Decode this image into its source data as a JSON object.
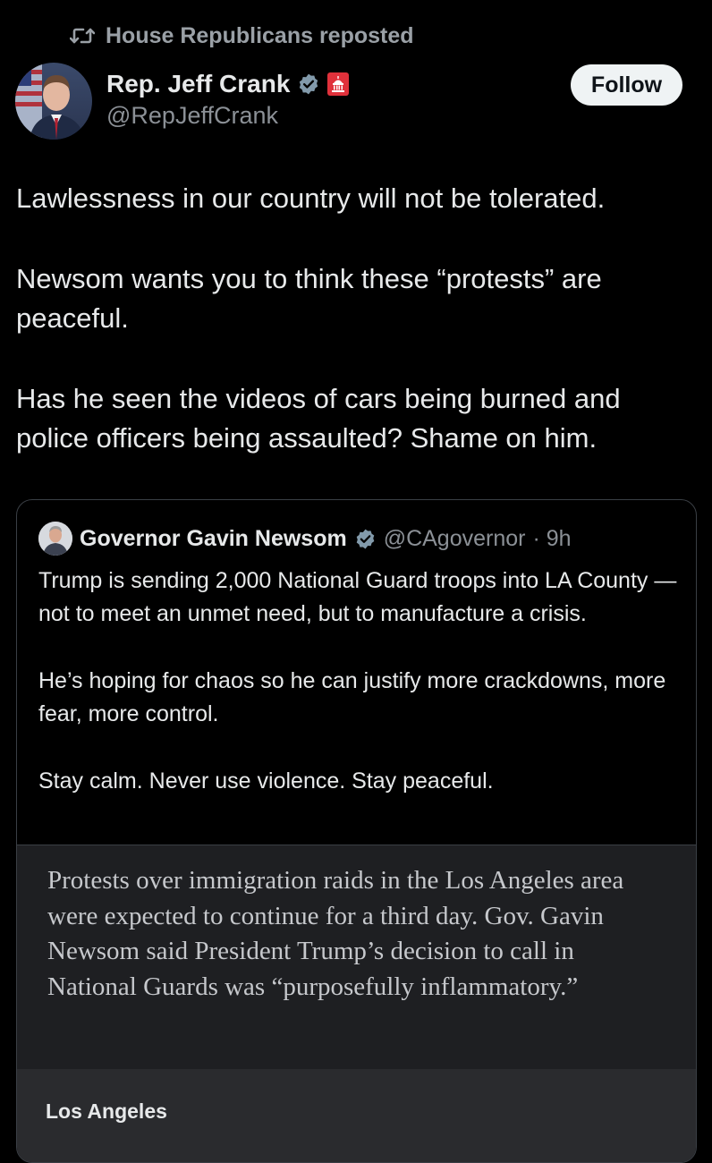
{
  "repost": {
    "label": "House Republicans reposted",
    "icon": "repost-icon"
  },
  "author": {
    "name": "Rep. Jeff Crank",
    "handle": "@RepJeffCrank",
    "verified_icon": "verified-badge-icon",
    "affiliation_icon": "government-badge-icon"
  },
  "follow": {
    "label": "Follow"
  },
  "post": {
    "paragraphs": [
      "Lawlessness in our country will not be tolerated.",
      "Newsom wants you to think these “protests” are peaceful.",
      "Has he seen the videos of cars being burned and police officers being assaulted? Shame on him."
    ]
  },
  "quote": {
    "name": "Governor Gavin Newsom",
    "handle": "@CAgovernor",
    "time": "· 9h",
    "paragraphs": [
      "Trump is sending 2,000 National Guard troops into LA County — not to meet an unmet need, but to manufacture a crisis.",
      "He’s hoping for chaos so he can justify more crackdowns, more fear, more control.",
      "Stay calm. Never use violence. Stay peaceful."
    ],
    "media": {
      "text": "Protests over immigration raids in the Los Angeles area were expected to continue for a third day. Gov. Gavin Newsom said President Trump’s decision to call in National Guards was “purposefully inflammatory.”",
      "tag": "Los Angeles"
    }
  },
  "colors": {
    "background": "#000000",
    "text": "#e7e9ea",
    "secondary": "#8b9096",
    "verified": "#829aab",
    "gov_badge": "#e0313b"
  }
}
